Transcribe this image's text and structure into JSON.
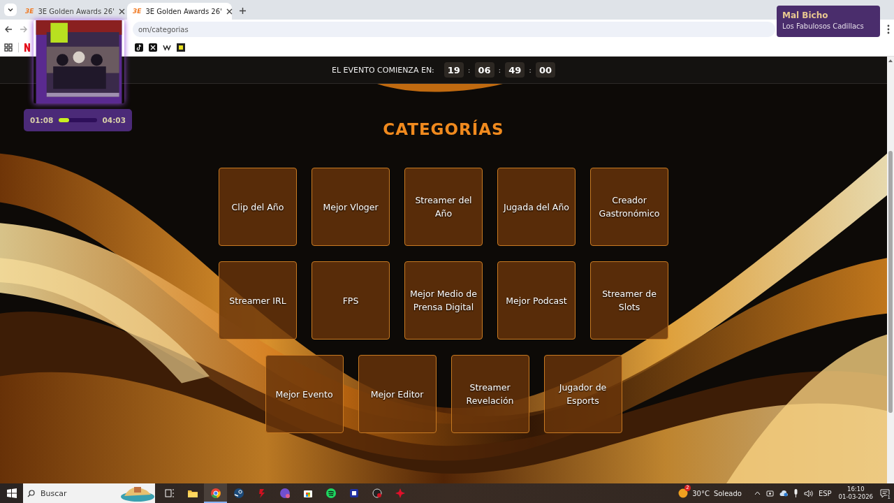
{
  "browser": {
    "tabs": [
      {
        "favicon": "3E",
        "label": "3E Golden Awards 26'",
        "selected": false
      },
      {
        "favicon": "3E",
        "label": "3E Golden Awards 26'",
        "selected": true
      }
    ],
    "address": "om/categorias"
  },
  "now_playing": {
    "elapsed": "01:08",
    "level": 0.27,
    "duration": "04:03"
  },
  "notification": {
    "title": "Mal Bicho",
    "subtitle": "Los Fabulosos Cadillacs"
  },
  "countdown": {
    "label": "EL EVENTO COMIENZA EN:",
    "separator": ":",
    "units": [
      "19",
      "06",
      "49",
      "00"
    ]
  },
  "heading": "CATEGORÍAS",
  "categories": [
    "Clip del Año",
    "Mejor Vloger",
    "Streamer del Año",
    "Jugada del Año",
    "Creador Gastronómico",
    "Streamer IRL",
    "FPS",
    "Mejor Medio de Prensa Digital",
    "Mejor Podcast",
    "Streamer de Slots",
    "Mejor Evento",
    "Mejor Editor",
    "Streamer Revelación",
    "Jugador de Esports"
  ],
  "taskbar": {
    "search_placeholder": "Buscar",
    "weather": {
      "badge": "2",
      "temperature": "30°C",
      "condition": "Soleado"
    },
    "language": "ESP",
    "time": "16:10",
    "date": "01-03-2026",
    "notifications": "1"
  }
}
